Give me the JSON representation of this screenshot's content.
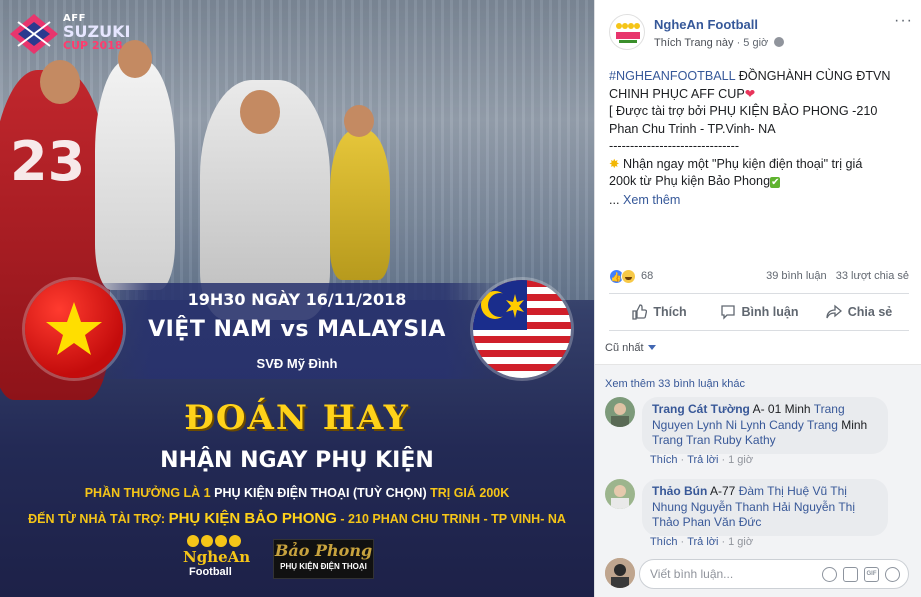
{
  "poster": {
    "event_logo": {
      "line1": "AFF",
      "line2": "SUZUKI",
      "line3": "CUP 2018"
    },
    "player_number": "23",
    "match_time": "19H30 NGÀY 16/11/2018",
    "match_teams": "VIỆT NAM vs MALAYSIA",
    "venue": "SVĐ Mỹ Đình",
    "headline": "ĐOÁN HAY",
    "subheadline": "NHẬN NGAY PHỤ KIỆN",
    "prize_prefix": "PHẦN THƯỞNG LÀ 1",
    "prize_item": "PHỤ KIỆN ĐIỆN THOẠI (TUỲ CHỌN)",
    "prize_suffix": "TRỊ GIÁ 200K",
    "sponsor_prefix": "ĐẾN TỪ NHÀ TÀI TRỢ:",
    "sponsor_name": "PHỤ KIỆN BẢO PHONG",
    "sponsor_address": "- 210 PHAN CHU TRINH - TP VINH- NA",
    "logo_nghean_top": "NgheAn",
    "logo_nghean_bottom": "Football",
    "logo_baophong_top": "Bảo Phong",
    "logo_baophong_bottom": "PHỤ KIỆN ĐIỆN THOẠI"
  },
  "post": {
    "page_name": "NgheAn Football",
    "like_page": "Thích Trang này",
    "time": "5 giờ",
    "lines": {
      "hashtag": "#NGHEANFOOTBALL",
      "l1_rest": " ĐỒNGHÀNH CÙNG ĐTVN",
      "l2": "CHINH PHỤC AFF CUP",
      "l3": "[ Được tài trợ bởi PHỤ KIỆN BẢO PHONG -210",
      "l4": "Phan Chu Trinh - TP.Vinh- NA",
      "l5": "-------------------------------",
      "l6": " Nhận ngay một \"Phụ kiện điện thoại\" trị giá",
      "l7": "200k từ Phụ kiện Bảo Phong",
      "see_more_prefix": "... ",
      "see_more": "Xem thêm"
    },
    "reaction_count": "68",
    "comment_count": "39 bình luận",
    "share_count": "33 lượt chia sẻ",
    "actions": {
      "like": "Thích",
      "comment": "Bình luận",
      "share": "Chia sẻ"
    },
    "sort_label": "Cũ nhất"
  },
  "comments": {
    "view_more": "Xem thêm 33 bình luận khác",
    "items": [
      {
        "author": "Trang Cát Tường",
        "text_a": " A- 01 Minh ",
        "tag_a": "Trang Nguyen Lynh Ni Lynh Candy Trang",
        "text_b": " Minh ",
        "tag_b": "Trang Tran Ruby Kathy",
        "like": "Thích",
        "reply": "Trả lời",
        "time": "1 giờ"
      },
      {
        "author": "Thảo Bún",
        "text_a": " A-77 ",
        "tag_a": "Đàm Thị Huệ Vũ Thị Nhung Nguyễn Thanh Hải Nguyễn Thị Thảo Phan Văn Đức",
        "like": "Thích",
        "reply": "Trả lời",
        "time": "1 giờ"
      }
    ]
  },
  "composer": {
    "placeholder": "Viết bình luận..."
  },
  "colors": {
    "link": "#385898",
    "accent_gold": "#ffd21a",
    "brand_blue": "#4267b2"
  },
  "icons": [
    "more-icon",
    "globe-icon",
    "like-icon",
    "comment-icon",
    "share-icon",
    "emoji-icon",
    "camera-icon",
    "gif-icon",
    "sticker-icon"
  ]
}
